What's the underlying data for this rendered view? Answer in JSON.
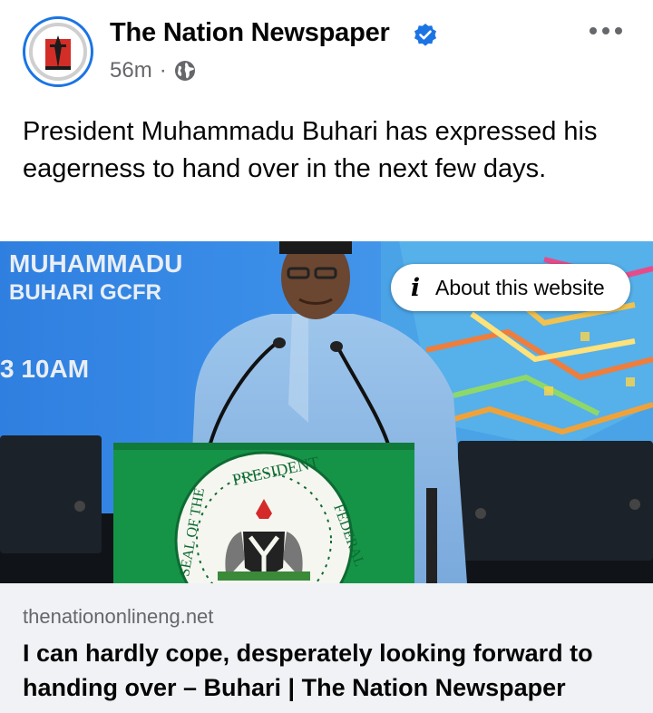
{
  "post": {
    "page_name": "The Nation Newspaper",
    "time": "56m",
    "separator": "·",
    "audience_icon": "globe-icon",
    "verified_icon": "verified-badge-icon",
    "more_icon": "more-options-icon",
    "text": "President Muhammadu Buhari has expressed his eagerness to hand over in the next few days."
  },
  "media": {
    "banner_line1": "MUHAMMADU",
    "banner_line2": "BUHARI GCFR",
    "banner_time": "3 10AM",
    "seal_text_top": "PRESIDENT",
    "seal_text_left": "SEAL OF THE",
    "seal_text_right": "FEDERAL",
    "about_icon": "info-icon",
    "about_label": "About this website"
  },
  "link": {
    "domain": "thenationonlineng.net",
    "title": "I can hardly cope, desperately looking forward to handing over – Buhari | The Nation Newspaper"
  },
  "colors": {
    "verified_blue": "#1b74e4",
    "podium_green": "#159447",
    "link_bg": "#f0f2f5",
    "meta_gray": "#65676b"
  }
}
